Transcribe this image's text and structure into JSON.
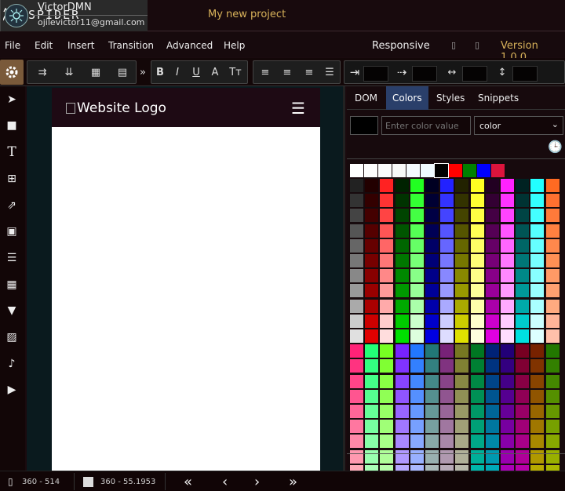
{
  "app": {
    "name": "SPIDER",
    "project": "My new project",
    "version": "Version 1.0.0"
  },
  "user": {
    "name": "VictorDMN",
    "email": "ojilevictor11@gmail.com"
  },
  "menu": [
    "File",
    "Edit",
    "Insert",
    "Transition",
    "Advanced",
    "Help"
  ],
  "responsive_label": "Responsive",
  "toolbar": {
    "bold": "B",
    "italic": "I",
    "underline": "U",
    "color": "A",
    "text_size": "Tт"
  },
  "preview": {
    "logo_alt": "Website Logo"
  },
  "panel": {
    "tabs": [
      "DOM",
      "Colors",
      "Styles",
      "Snippets"
    ],
    "active_tab": "Colors",
    "color_input_placeholder": "Enter color value",
    "color_select_value": "color",
    "swatch_color": "#000000"
  },
  "status": {
    "viewport": "360 - 514",
    "size": "360 - 55.1953"
  },
  "palette": {
    "top_row": [
      "#ffffff",
      "#fdfdfd",
      "#fbfbfb",
      "#f8f8f8",
      "#f5fafe",
      "#f0fbff",
      "#000000",
      "#ff0000",
      "#008000",
      "#0000ff",
      "#dc143c"
    ],
    "columns": [
      [
        "#222222",
        "#333333",
        "#444444",
        "#555555",
        "#666666",
        "#777777",
        "#888888",
        "#999999",
        "#aaaaaa",
        "#cccccc",
        "#e0e0e0"
      ],
      [
        "#220000",
        "#330000",
        "#440000",
        "#550000",
        "#660000",
        "#770000",
        "#880000",
        "#990000",
        "#aa0000",
        "#cc0000",
        "#e00000"
      ],
      [
        "#ff2222",
        "#ff3333",
        "#ff4444",
        "#ff5555",
        "#ff6666",
        "#ff7777",
        "#ff8888",
        "#ff9999",
        "#ffaaaa",
        "#ffcccc",
        "#ffdddd"
      ],
      [
        "#002200",
        "#003300",
        "#004400",
        "#005500",
        "#006600",
        "#007700",
        "#008800",
        "#009900",
        "#00aa00",
        "#00cc00",
        "#00e000"
      ],
      [
        "#22ff22",
        "#33ff33",
        "#44ff44",
        "#55ff55",
        "#66ff66",
        "#77ff77",
        "#88ff88",
        "#99ff99",
        "#aaffaa",
        "#ccffcc",
        "#ddffdd"
      ],
      [
        "#000022",
        "#000033",
        "#000044",
        "#000055",
        "#000066",
        "#000077",
        "#000088",
        "#000099",
        "#0000aa",
        "#0000cc",
        "#0000e0"
      ],
      [
        "#2222ff",
        "#3333ff",
        "#4444ff",
        "#5555ff",
        "#6666ff",
        "#7777ff",
        "#8888ff",
        "#9999ff",
        "#aaaaff",
        "#ccccff",
        "#ddddff"
      ],
      [
        "#222200",
        "#333300",
        "#444400",
        "#555500",
        "#666600",
        "#777700",
        "#888800",
        "#999900",
        "#aaaa00",
        "#cccc00",
        "#e0e000"
      ],
      [
        "#ffff22",
        "#ffff33",
        "#ffff44",
        "#ffff55",
        "#ffff66",
        "#ffff77",
        "#ffff88",
        "#ffff99",
        "#ffffaa",
        "#ffffcc",
        "#ffffdd"
      ],
      [
        "#220022",
        "#330033",
        "#440044",
        "#550055",
        "#660066",
        "#770077",
        "#880088",
        "#990099",
        "#aa00aa",
        "#cc00cc",
        "#e000e0"
      ],
      [
        "#ff22ff",
        "#ff33ff",
        "#ff44ff",
        "#ff55ff",
        "#ff66ff",
        "#ff77ff",
        "#ff88ff",
        "#ff99ff",
        "#ffaaff",
        "#ffccff",
        "#ffddff"
      ],
      [
        "#002222",
        "#003333",
        "#004444",
        "#005555",
        "#006666",
        "#007777",
        "#008888",
        "#009999",
        "#00aaaa",
        "#00cccc",
        "#00e0e0"
      ],
      [
        "#22ffff",
        "#33ffff",
        "#44ffff",
        "#55ffff",
        "#66ffff",
        "#77ffff",
        "#88ffff",
        "#99ffff",
        "#aaffff",
        "#ccffff",
        "#ddffff"
      ],
      [
        "#ff6a22",
        "#ff7030",
        "#ff7a3a",
        "#ff8040",
        "#ff884c",
        "#ff9055",
        "#ff9a66",
        "#ffa070",
        "#ffaa80",
        "#ffb499",
        "#ffc0aa"
      ]
    ],
    "lower_rows": [
      [
        "#ff2277",
        "#22ff77",
        "#77ff22",
        "#7722ff",
        "#2277ff",
        "#227777",
        "#772277",
        "#777722",
        "#007722",
        "#002277",
        "#220077",
        "#770022",
        "#772200",
        "#227700"
      ],
      [
        "#ff3380",
        "#33ff80",
        "#80ff33",
        "#8033ff",
        "#3380ff",
        "#338080",
        "#803380",
        "#808033",
        "#008033",
        "#003380",
        "#330080",
        "#800033",
        "#803300",
        "#338000"
      ],
      [
        "#ff4488",
        "#44ff88",
        "#88ff44",
        "#8844ff",
        "#4488ff",
        "#448888",
        "#884488",
        "#888844",
        "#008844",
        "#004488",
        "#440088",
        "#880044",
        "#884400",
        "#448800"
      ],
      [
        "#ff5590",
        "#55ff90",
        "#90ff55",
        "#9055ff",
        "#5590ff",
        "#559090",
        "#905590",
        "#909055",
        "#009055",
        "#005590",
        "#550090",
        "#900055",
        "#905500",
        "#559000"
      ],
      [
        "#ff6698",
        "#66ff98",
        "#98ff66",
        "#9866ff",
        "#6698ff",
        "#669898",
        "#986698",
        "#989866",
        "#009866",
        "#006698",
        "#660098",
        "#980066",
        "#986600",
        "#669800"
      ],
      [
        "#ff77a0",
        "#77ffa0",
        "#a0ff77",
        "#a077ff",
        "#77a0ff",
        "#77a0a0",
        "#a077a0",
        "#a0a077",
        "#00a077",
        "#0077a0",
        "#7700a0",
        "#a00077",
        "#a07700",
        "#77a000"
      ],
      [
        "#ff88a8",
        "#88ffa8",
        "#a8ff88",
        "#a888ff",
        "#88a8ff",
        "#88a8a8",
        "#a888a8",
        "#a8a888",
        "#00a888",
        "#0088a8",
        "#8800a8",
        "#a80088",
        "#a88800",
        "#88a800"
      ],
      [
        "#ff99b0",
        "#99ffb0",
        "#b0ff99",
        "#b099ff",
        "#99b0ff",
        "#99b0b0",
        "#b099b0",
        "#b0b099",
        "#00b099",
        "#0099b0",
        "#9900b0",
        "#b00099",
        "#b09900",
        "#99b000"
      ],
      [
        "#ffaab8",
        "#aaffb8",
        "#b8ffaa",
        "#b8aaff",
        "#aab8ff",
        "#aab8b8",
        "#b8aab8",
        "#b8b8aa",
        "#00b8aa",
        "#00aab8",
        "#aa00b8",
        "#b800aa",
        "#b8aa00",
        "#aab800"
      ]
    ]
  }
}
